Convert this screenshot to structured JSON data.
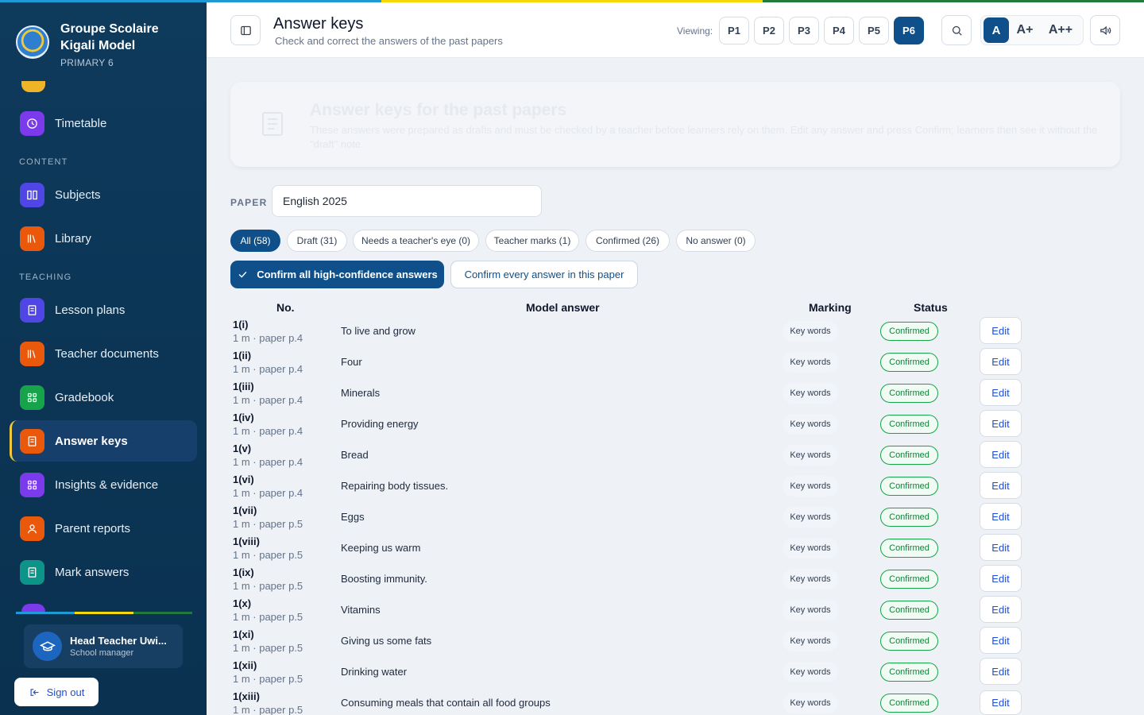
{
  "school": {
    "name": "Groupe Scolaire Kigali Model",
    "class": "PRIMARY 6"
  },
  "sidebar": {
    "items": [
      {
        "label": "Timetable",
        "color": "#7c3aed"
      },
      {
        "section": "CONTENT"
      },
      {
        "label": "Subjects",
        "color": "#4f46e5"
      },
      {
        "label": "Library",
        "color": "#ea580c"
      },
      {
        "section": "TEACHING"
      },
      {
        "label": "Lesson plans",
        "color": "#4f46e5"
      },
      {
        "label": "Teacher documents",
        "color": "#ea580c"
      },
      {
        "label": "Gradebook",
        "color": "#16a34a"
      },
      {
        "label": "Answer keys",
        "color": "#ea580c",
        "active": true
      },
      {
        "label": "Insights & evidence",
        "color": "#7c3aed"
      },
      {
        "label": "Parent reports",
        "color": "#ea580c"
      },
      {
        "label": "Mark answers",
        "color": "#0d9488"
      }
    ],
    "user": {
      "name": "Head Teacher Uwi...",
      "role": "School manager"
    },
    "sign_out": "Sign out"
  },
  "header": {
    "title": "Answer keys",
    "subtitle": "Check and correct the answers of the past papers",
    "viewing_label": "Viewing:",
    "levels": [
      "P1",
      "P2",
      "P3",
      "P4",
      "P5",
      "P6"
    ],
    "selected_level": "P6",
    "font_sizes": [
      "A",
      "A+",
      "A++"
    ]
  },
  "banner": {
    "title": "Answer keys for the past papers",
    "description": "These answers were prepared as drafts and must be checked by a teacher before learners rely on them. Edit any answer and press Confirm; learners then see it without the \"draft\" note."
  },
  "paper": {
    "label": "PAPER",
    "value": "English 2025"
  },
  "filters": [
    {
      "label": "All (58)",
      "active": true
    },
    {
      "label": "Draft (31)"
    },
    {
      "label": "Needs a teacher's eye (0)"
    },
    {
      "label": "Teacher marks (1)"
    },
    {
      "label": "Confirmed (26)"
    },
    {
      "label": "No answer (0)"
    }
  ],
  "actions": {
    "confirm_high": "Confirm all high-confidence answers",
    "confirm_all": "Confirm every answer in this paper"
  },
  "table": {
    "columns": [
      "No.",
      "Model answer",
      "Marking",
      "Status"
    ],
    "rows": [
      {
        "no": "1(i)",
        "meta": "1 m · paper p.4",
        "answer": "To live and grow",
        "marking": "Key words",
        "status": "Confirmed",
        "action": "Edit"
      },
      {
        "no": "1(ii)",
        "meta": "1 m · paper p.4",
        "answer": "Four",
        "marking": "Key words",
        "status": "Confirmed",
        "action": "Edit"
      },
      {
        "no": "1(iii)",
        "meta": "1 m · paper p.4",
        "answer": "Minerals",
        "marking": "Key words",
        "status": "Confirmed",
        "action": "Edit"
      },
      {
        "no": "1(iv)",
        "meta": "1 m · paper p.4",
        "answer": "Providing energy",
        "marking": "Key words",
        "status": "Confirmed",
        "action": "Edit"
      },
      {
        "no": "1(v)",
        "meta": "1 m · paper p.4",
        "answer": "Bread",
        "marking": "Key words",
        "status": "Confirmed",
        "action": "Edit"
      },
      {
        "no": "1(vi)",
        "meta": "1 m · paper p.4",
        "answer": "Repairing body tissues.",
        "marking": "Key words",
        "status": "Confirmed",
        "action": "Edit"
      },
      {
        "no": "1(vii)",
        "meta": "1 m · paper p.5",
        "answer": "Eggs",
        "marking": "Key words",
        "status": "Confirmed",
        "action": "Edit"
      },
      {
        "no": "1(viii)",
        "meta": "1 m · paper p.5",
        "answer": "Keeping us warm",
        "marking": "Key words",
        "status": "Confirmed",
        "action": "Edit"
      },
      {
        "no": "1(ix)",
        "meta": "1 m · paper p.5",
        "answer": "Boosting immunity.",
        "marking": "Key words",
        "status": "Confirmed",
        "action": "Edit"
      },
      {
        "no": "1(x)",
        "meta": "1 m · paper p.5",
        "answer": "Vitamins",
        "marking": "Key words",
        "status": "Confirmed",
        "action": "Edit"
      },
      {
        "no": "1(xi)",
        "meta": "1 m · paper p.5",
        "answer": "Giving us some fats",
        "marking": "Key words",
        "status": "Confirmed",
        "action": "Edit"
      },
      {
        "no": "1(xii)",
        "meta": "1 m · paper p.5",
        "answer": "Drinking water",
        "marking": "Key words",
        "status": "Confirmed",
        "action": "Edit"
      },
      {
        "no": "1(xiii)",
        "meta": "1 m · paper p.5",
        "answer": "Consuming meals that contain all food groups",
        "marking": "Key words",
        "status": "Confirmed",
        "action": "Edit"
      }
    ]
  },
  "colors": {
    "brand": "#0f4f8a",
    "flag_blue": "#1f9ad6",
    "flag_yellow": "#f5d90a",
    "flag_green": "#1f7a3b",
    "confirmed": "#16a34a"
  }
}
